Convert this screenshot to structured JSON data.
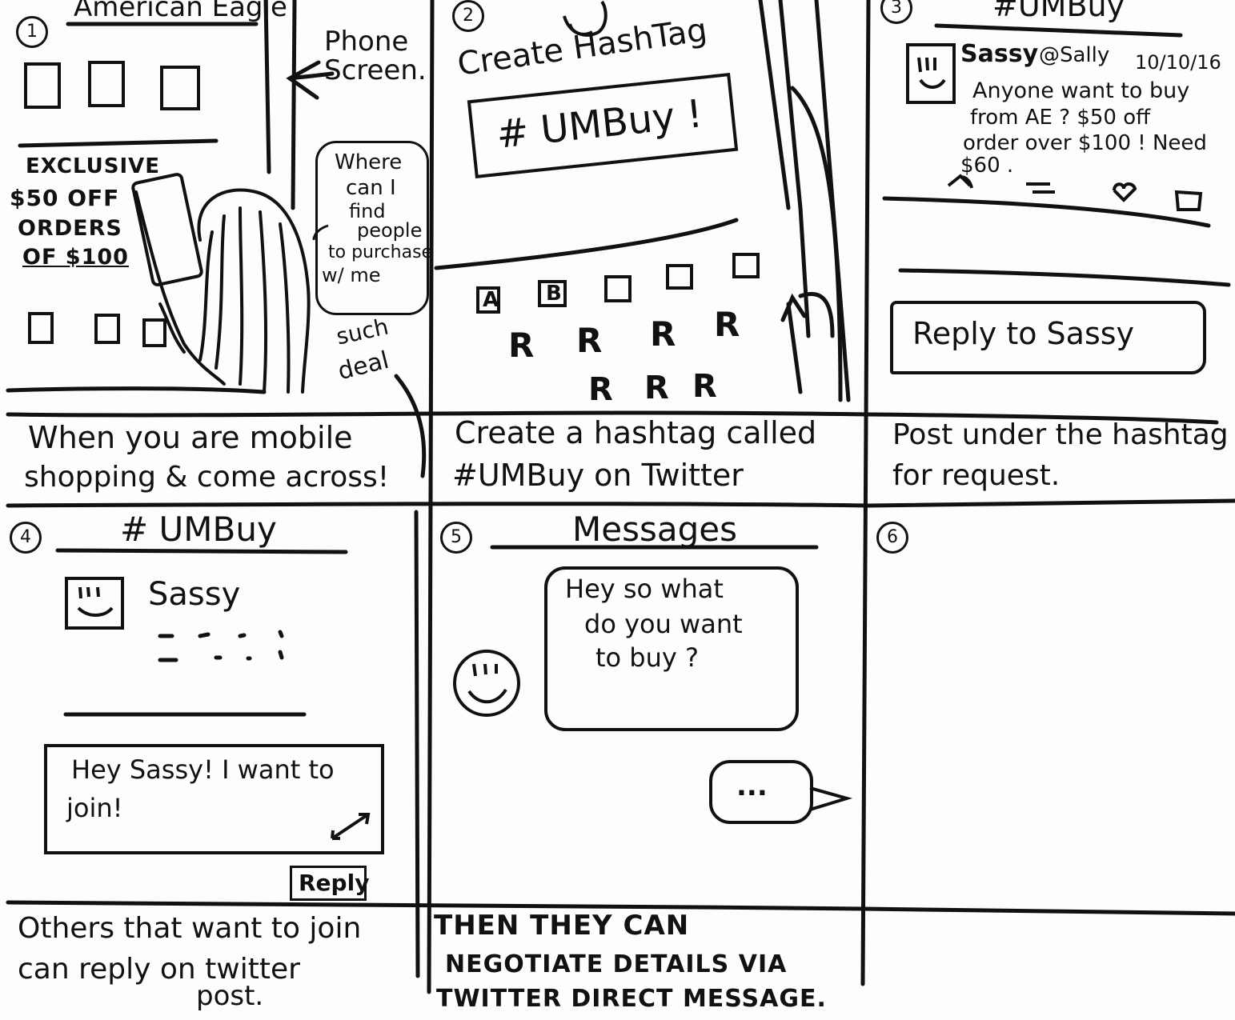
{
  "panels": [
    {
      "number": "1",
      "header": "American Eagle",
      "promo_lines": [
        "EXCLUSIVE",
        "$50 OFF",
        "ORDERS",
        "OF $100"
      ],
      "annotation_phone": "Phone Screen.",
      "thought_bubble": [
        "Where",
        "can I",
        "find",
        "people",
        "to purchase",
        "w/ me"
      ],
      "annotation_deal": [
        "such",
        "deal"
      ],
      "caption_lines": [
        "When you are mobile",
        "shopping & come across!"
      ]
    },
    {
      "number": "2",
      "title": "Create HashTag",
      "input_value": "# UMBuy !",
      "keyboard_row1": [
        "A",
        "B",
        "",
        "",
        ""
      ],
      "keyboard_row2": [
        "R",
        "R",
        "R",
        "R"
      ],
      "keyboard_row3": [
        "R",
        "R",
        "R"
      ],
      "caption_lines": [
        "Create a hashtag called",
        "#UMBuy on Twitter"
      ]
    },
    {
      "number": "3",
      "header": "#UMBuy",
      "tweet_user": "Sassy",
      "tweet_handle": "@Sally",
      "tweet_date": "10/10/16",
      "tweet_text": [
        "Anyone want to buy",
        "from AE ? $50 off",
        "order over $100 ! Need",
        "$60 ."
      ],
      "reply_placeholder": "Reply to Sassy",
      "caption_lines": [
        "Post under the hashtag",
        "for request."
      ]
    },
    {
      "number": "4",
      "header": "# UMBuy",
      "user": "Sassy",
      "reply_text": [
        "Hey Sassy! I want to",
        "join!"
      ],
      "reply_button": "Reply",
      "caption_lines": [
        "Others that want to join",
        "can reply on twitter",
        "post."
      ]
    },
    {
      "number": "5",
      "header": "Messages",
      "message": [
        "Hey so what",
        "do you want",
        "to buy ?"
      ],
      "typing": "...",
      "caption_lines": [
        "THEN THEY CAN",
        "NEGOTIATE DETAILS VIA",
        "TWITTER DIRECT MESSAGE."
      ]
    },
    {
      "number": "6"
    }
  ]
}
